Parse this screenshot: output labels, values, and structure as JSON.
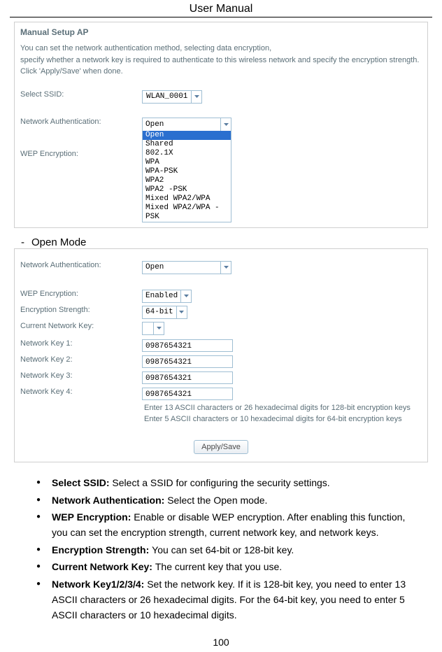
{
  "page": {
    "header": "User Manual",
    "page_number": "100"
  },
  "panel1": {
    "title": "Manual Setup AP",
    "desc_l1": "You can set the network authentication method, selecting data encryption,",
    "desc_l2": "specify whether a network key is required to authenticate to this wireless network and specify the encryption strength.",
    "desc_l3": "Click 'Apply/Save' when done.",
    "ssid_label": "Select SSID:",
    "ssid_value": "WLAN_0001",
    "auth_label": "Network Authentication:",
    "auth_value": "Open",
    "auth_options": [
      "Open",
      "Shared",
      "802.1X",
      "WPA",
      "WPA-PSK",
      "WPA2",
      "WPA2 -PSK",
      "Mixed WPA2/WPA",
      "Mixed WPA2/WPA -PSK"
    ],
    "wep_label": "WEP Encryption:"
  },
  "section_heading": "Open Mode",
  "panel2": {
    "auth_label": "Network Authentication:",
    "auth_value": "Open",
    "wep_label": "WEP Encryption:",
    "wep_value": "Enabled",
    "strength_label": "Encryption Strength:",
    "strength_value": "64-bit",
    "curkey_label": "Current Network Key:",
    "curkey_value": "",
    "k1_label": "Network Key 1:",
    "k2_label": "Network Key 2:",
    "k3_label": "Network Key 3:",
    "k4_label": "Network Key 4:",
    "key_value": "0987654321",
    "hint1": "Enter 13 ASCII characters or 26 hexadecimal digits for 128-bit encryption keys",
    "hint2": "Enter 5 ASCII characters or 10 hexadecimal digits for 64-bit encryption keys",
    "apply": "Apply/Save"
  },
  "bullets": {
    "b1_bold": "Select SSID: ",
    "b1_text": "Select a SSID for configuring the security settings.",
    "b2_bold": "Network Authentication: ",
    "b2_text": "Select the Open mode.",
    "b3_bold": "WEP Encryption: ",
    "b3_text": "Enable or disable WEP encryption. After enabling this function, you can set the encryption strength, current network key, and network keys.",
    "b4_bold": "Encryption Strength: ",
    "b4_text": "You can set 64-bit or 128-bit key.",
    "b5_bold": "Current Network Key: ",
    "b5_text": "The current key that you use.",
    "b6_bold": "Network Key1/2/3/4: ",
    "b6_text": "Set the network key. If it is 128-bit key, you need to enter 13 ASCII characters or 26 hexadecimal digits. For the 64-bit key, you need to enter 5 ASCII characters or 10 hexadecimal digits."
  }
}
